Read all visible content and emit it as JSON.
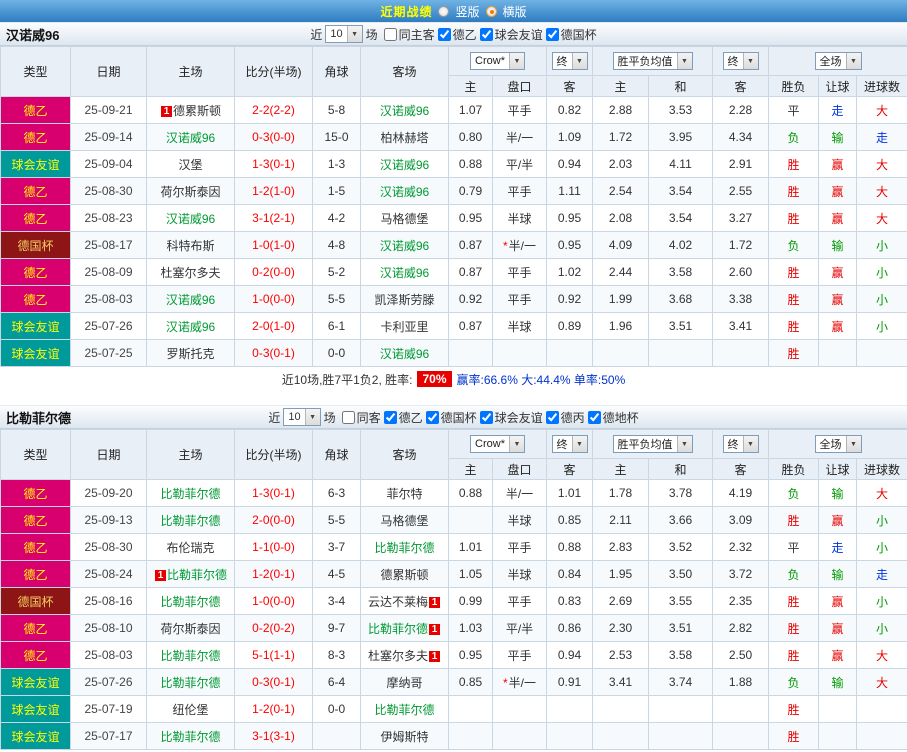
{
  "topbar": {
    "title": "近期战绩",
    "options": [
      {
        "label": "竖版",
        "selected": false
      },
      {
        "label": "横版",
        "selected": true
      }
    ]
  },
  "table_header": {
    "type": "类型",
    "date": "日期",
    "home": "主场",
    "score": "比分(半场)",
    "corner": "角球",
    "away": "客场",
    "crow": "Crow*",
    "end": "终",
    "avg": "胜平负均值",
    "full": "全场",
    "home_odds": "主",
    "handicap": "盘口",
    "away_odds": "客",
    "home_avg": "主",
    "draw_avg": "和",
    "away_avg": "客",
    "result": "胜负",
    "handicap_result": "让球",
    "goals": "进球数"
  },
  "colors": {
    "topbar_top": "#6fb2e4",
    "topbar_bottom": "#2e7cc2",
    "title_yellow": "#ffff00",
    "league2_bg": "#d8006e",
    "friendly_bg": "#009a9a",
    "cup_bg": "#8e1515",
    "type_text": "#ffff00",
    "score_red": "#ff0000",
    "focus_green": "#009933",
    "win_red": "#e60000",
    "lose_green": "#009900",
    "push_blue": "#0033dd",
    "badge_red": "#e60000",
    "rate_badge_bg": "#e60000",
    "stats_blue": "#0033cc",
    "grid_border": "#c9d6e4",
    "header_bg": "#e9eff6",
    "row_alt": "#f6fafd",
    "teambar_from": "#fcfdfe",
    "teambar_to": "#dde6f0"
  },
  "sections": [
    {
      "team": "汉诺威96",
      "filter": {
        "near_label": "近",
        "count": "10",
        "games_label": "场",
        "checkboxes": [
          {
            "label": "同主客",
            "checked": false
          },
          {
            "label": "德乙",
            "checked": true
          },
          {
            "label": "球会友谊",
            "checked": true
          },
          {
            "label": "德国杯",
            "checked": true
          }
        ]
      },
      "rows": [
        {
          "league": "德乙",
          "league_cls": "league2",
          "date": "25-09-21",
          "home": "德累斯顿",
          "home_focus": false,
          "home_badge": "1",
          "score": "2-2(2-2)",
          "corner": "5-8",
          "away": "汉诺威96",
          "away_focus": true,
          "away_badge": "",
          "odds": [
            "1.07",
            "平手",
            "0.82",
            "2.88",
            "3.53",
            "2.28"
          ],
          "results": [
            [
              "平",
              "plain"
            ],
            [
              "走",
              "blue"
            ],
            [
              "大",
              "red"
            ]
          ]
        },
        {
          "league": "德乙",
          "league_cls": "league2",
          "date": "25-09-14",
          "home": "汉诺威96",
          "home_focus": true,
          "home_badge": "",
          "score": "0-3(0-0)",
          "corner": "15-0",
          "away": "柏林赫塔",
          "away_focus": false,
          "away_badge": "",
          "odds": [
            "0.80",
            "半/一",
            "1.09",
            "1.72",
            "3.95",
            "4.34"
          ],
          "results": [
            [
              "负",
              "green"
            ],
            [
              "输",
              "green"
            ],
            [
              "走",
              "blue"
            ]
          ]
        },
        {
          "league": "球会友谊",
          "league_cls": "friendly",
          "date": "25-09-04",
          "home": "汉堡",
          "home_focus": false,
          "home_badge": "",
          "score": "1-3(0-1)",
          "corner": "1-3",
          "away": "汉诺威96",
          "away_focus": true,
          "away_badge": "",
          "odds": [
            "0.88",
            "平/半",
            "0.94",
            "2.03",
            "4.11",
            "2.91"
          ],
          "results": [
            [
              "胜",
              "red"
            ],
            [
              "赢",
              "red"
            ],
            [
              "大",
              "red"
            ]
          ]
        },
        {
          "league": "德乙",
          "league_cls": "league2",
          "date": "25-08-30",
          "home": "荷尔斯泰因",
          "home_focus": false,
          "home_badge": "",
          "score": "1-2(1-0)",
          "corner": "1-5",
          "away": "汉诺威96",
          "away_focus": true,
          "away_badge": "",
          "odds": [
            "0.79",
            "平手",
            "1.11",
            "2.54",
            "3.54",
            "2.55"
          ],
          "results": [
            [
              "胜",
              "red"
            ],
            [
              "赢",
              "red"
            ],
            [
              "大",
              "red"
            ]
          ]
        },
        {
          "league": "德乙",
          "league_cls": "league2",
          "date": "25-08-23",
          "home": "汉诺威96",
          "home_focus": true,
          "home_badge": "",
          "score": "3-1(2-1)",
          "corner": "4-2",
          "away": "马格德堡",
          "away_focus": false,
          "away_badge": "",
          "odds": [
            "0.95",
            "半球",
            "0.95",
            "2.08",
            "3.54",
            "3.27"
          ],
          "results": [
            [
              "胜",
              "red"
            ],
            [
              "赢",
              "red"
            ],
            [
              "大",
              "red"
            ]
          ]
        },
        {
          "league": "德国杯",
          "league_cls": "cup",
          "date": "25-08-17",
          "home": "科特布斯",
          "home_focus": false,
          "home_badge": "",
          "score": "1-0(1-0)",
          "corner": "4-8",
          "away": "汉诺威96",
          "away_focus": true,
          "away_badge": "",
          "odds": [
            "0.87",
            "*半/一",
            "0.95",
            "4.09",
            "4.02",
            "1.72"
          ],
          "results": [
            [
              "负",
              "green"
            ],
            [
              "输",
              "green"
            ],
            [
              "小",
              "green"
            ]
          ]
        },
        {
          "league": "德乙",
          "league_cls": "league2",
          "date": "25-08-09",
          "home": "杜塞尔多夫",
          "home_focus": false,
          "home_badge": "",
          "score": "0-2(0-0)",
          "corner": "5-2",
          "away": "汉诺威96",
          "away_focus": true,
          "away_badge": "",
          "odds": [
            "0.87",
            "平手",
            "1.02",
            "2.44",
            "3.58",
            "2.60"
          ],
          "results": [
            [
              "胜",
              "red"
            ],
            [
              "赢",
              "red"
            ],
            [
              "小",
              "green"
            ]
          ]
        },
        {
          "league": "德乙",
          "league_cls": "league2",
          "date": "25-08-03",
          "home": "汉诺威96",
          "home_focus": true,
          "home_badge": "",
          "score": "1-0(0-0)",
          "corner": "5-5",
          "away": "凯泽斯劳滕",
          "away_focus": false,
          "away_badge": "",
          "odds": [
            "0.92",
            "平手",
            "0.92",
            "1.99",
            "3.68",
            "3.38"
          ],
          "results": [
            [
              "胜",
              "red"
            ],
            [
              "赢",
              "red"
            ],
            [
              "小",
              "green"
            ]
          ]
        },
        {
          "league": "球会友谊",
          "league_cls": "friendly",
          "date": "25-07-26",
          "home": "汉诺威96",
          "home_focus": true,
          "home_badge": "",
          "score": "2-0(1-0)",
          "corner": "6-1",
          "away": "卡利亚里",
          "away_focus": false,
          "away_badge": "",
          "odds": [
            "0.87",
            "半球",
            "0.89",
            "1.96",
            "3.51",
            "3.41"
          ],
          "results": [
            [
              "胜",
              "red"
            ],
            [
              "赢",
              "red"
            ],
            [
              "小",
              "green"
            ]
          ]
        },
        {
          "league": "球会友谊",
          "league_cls": "friendly",
          "date": "25-07-25",
          "home": "罗斯托克",
          "home_focus": false,
          "home_badge": "",
          "score": "0-3(0-1)",
          "corner": "0-0",
          "away": "汉诺威96",
          "away_focus": true,
          "away_badge": "",
          "odds": [
            "",
            "",
            "",
            "",
            "",
            ""
          ],
          "results": [
            [
              "胜",
              "red"
            ],
            [
              "",
              ""
            ],
            [
              "",
              ""
            ]
          ]
        }
      ],
      "summary": {
        "prefix": "近10场,胜7平1负2, 胜率:",
        "win_rate": "70%",
        "stats": "赢率:66.6% 大:44.4% 单率:50%"
      }
    },
    {
      "team": "比勒菲尔德",
      "filter": {
        "near_label": "近",
        "count": "10",
        "games_label": "场",
        "checkboxes": [
          {
            "label": "同客",
            "checked": false
          },
          {
            "label": "德乙",
            "checked": true
          },
          {
            "label": "德国杯",
            "checked": true
          },
          {
            "label": "球会友谊",
            "checked": true
          },
          {
            "label": "德丙",
            "checked": true
          },
          {
            "label": "德地杯",
            "checked": true
          }
        ]
      },
      "rows": [
        {
          "league": "德乙",
          "league_cls": "league2",
          "date": "25-09-20",
          "home": "比勒菲尔德",
          "home_focus": true,
          "home_badge": "",
          "score": "1-3(0-1)",
          "corner": "6-3",
          "away": "菲尔特",
          "away_focus": false,
          "away_badge": "",
          "odds": [
            "0.88",
            "半/一",
            "1.01",
            "1.78",
            "3.78",
            "4.19"
          ],
          "results": [
            [
              "负",
              "green"
            ],
            [
              "输",
              "green"
            ],
            [
              "大",
              "red"
            ]
          ]
        },
        {
          "league": "德乙",
          "league_cls": "league2",
          "date": "25-09-13",
          "home": "比勒菲尔德",
          "home_focus": true,
          "home_badge": "",
          "score": "2-0(0-0)",
          "corner": "5-5",
          "away": "马格德堡",
          "away_focus": false,
          "away_badge": "",
          "odds": [
            "",
            "半球",
            "0.85",
            "2.11",
            "3.66",
            "3.09"
          ],
          "results": [
            [
              "胜",
              "red"
            ],
            [
              "赢",
              "red"
            ],
            [
              "小",
              "green"
            ]
          ]
        },
        {
          "league": "德乙",
          "league_cls": "league2",
          "date": "25-08-30",
          "home": "布伦瑞克",
          "home_focus": false,
          "home_badge": "",
          "score": "1-1(0-0)",
          "corner": "3-7",
          "away": "比勒菲尔德",
          "away_focus": true,
          "away_badge": "",
          "odds": [
            "1.01",
            "平手",
            "0.88",
            "2.83",
            "3.52",
            "2.32"
          ],
          "results": [
            [
              "平",
              "plain"
            ],
            [
              "走",
              "blue"
            ],
            [
              "小",
              "green"
            ]
          ]
        },
        {
          "league": "德乙",
          "league_cls": "league2",
          "date": "25-08-24",
          "home": "比勒菲尔德",
          "home_focus": true,
          "home_badge": "1",
          "score": "1-2(0-1)",
          "corner": "4-5",
          "away": "德累斯顿",
          "away_focus": false,
          "away_badge": "",
          "odds": [
            "1.05",
            "半球",
            "0.84",
            "1.95",
            "3.50",
            "3.72"
          ],
          "results": [
            [
              "负",
              "green"
            ],
            [
              "输",
              "green"
            ],
            [
              "走",
              "blue"
            ]
          ]
        },
        {
          "league": "德国杯",
          "league_cls": "cup",
          "date": "25-08-16",
          "home": "比勒菲尔德",
          "home_focus": true,
          "home_badge": "",
          "score": "1-0(0-0)",
          "corner": "3-4",
          "away": "云达不莱梅",
          "away_focus": false,
          "away_badge": "1",
          "odds": [
            "0.99",
            "平手",
            "0.83",
            "2.69",
            "3.55",
            "2.35"
          ],
          "results": [
            [
              "胜",
              "red"
            ],
            [
              "赢",
              "red"
            ],
            [
              "小",
              "green"
            ]
          ]
        },
        {
          "league": "德乙",
          "league_cls": "league2",
          "date": "25-08-10",
          "home": "荷尔斯泰因",
          "home_focus": false,
          "home_badge": "",
          "score": "0-2(0-2)",
          "corner": "9-7",
          "away": "比勒菲尔德",
          "away_focus": true,
          "away_badge": "1",
          "odds": [
            "1.03",
            "平/半",
            "0.86",
            "2.30",
            "3.51",
            "2.82"
          ],
          "results": [
            [
              "胜",
              "red"
            ],
            [
              "赢",
              "red"
            ],
            [
              "小",
              "green"
            ]
          ]
        },
        {
          "league": "德乙",
          "league_cls": "league2",
          "date": "25-08-03",
          "home": "比勒菲尔德",
          "home_focus": true,
          "home_badge": "",
          "score": "5-1(1-1)",
          "corner": "8-3",
          "away": "杜塞尔多夫",
          "away_focus": false,
          "away_badge": "1",
          "odds": [
            "0.95",
            "平手",
            "0.94",
            "2.53",
            "3.58",
            "2.50"
          ],
          "results": [
            [
              "胜",
              "red"
            ],
            [
              "赢",
              "red"
            ],
            [
              "大",
              "red"
            ]
          ]
        },
        {
          "league": "球会友谊",
          "league_cls": "friendly",
          "date": "25-07-26",
          "home": "比勒菲尔德",
          "home_focus": true,
          "home_badge": "",
          "score": "0-3(0-1)",
          "corner": "6-4",
          "away": "摩纳哥",
          "away_focus": false,
          "away_badge": "",
          "odds": [
            "0.85",
            "*半/一",
            "0.91",
            "3.41",
            "3.74",
            "1.88"
          ],
          "results": [
            [
              "负",
              "green"
            ],
            [
              "输",
              "green"
            ],
            [
              "大",
              "red"
            ]
          ]
        },
        {
          "league": "球会友谊",
          "league_cls": "friendly",
          "date": "25-07-19",
          "home": "纽伦堡",
          "home_focus": false,
          "home_badge": "",
          "score": "1-2(0-1)",
          "corner": "0-0",
          "away": "比勒菲尔德",
          "away_focus": true,
          "away_badge": "",
          "odds": [
            "",
            "",
            "",
            "",
            "",
            ""
          ],
          "results": [
            [
              "胜",
              "red"
            ],
            [
              "",
              ""
            ],
            [
              "",
              ""
            ]
          ]
        },
        {
          "league": "球会友谊",
          "league_cls": "friendly",
          "date": "25-07-17",
          "home": "比勒菲尔德",
          "home_focus": true,
          "home_badge": "",
          "score": "3-1(3-1)",
          "corner": "",
          "away": "伊姆斯特",
          "away_focus": false,
          "away_badge": "",
          "odds": [
            "",
            "",
            "",
            "",
            "",
            ""
          ],
          "results": [
            [
              "胜",
              "red"
            ],
            [
              "",
              ""
            ],
            [
              "",
              ""
            ]
          ]
        }
      ]
    }
  ]
}
